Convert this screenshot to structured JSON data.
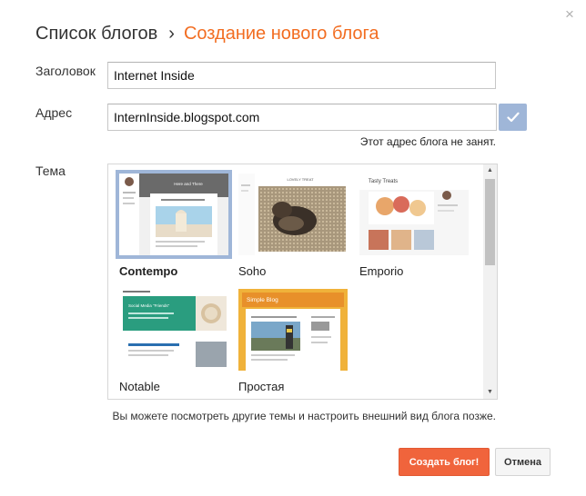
{
  "dialog": {
    "close_glyph": "×",
    "breadcrumb_root": "Список блогов",
    "breadcrumb_sep": "›",
    "breadcrumb_current": "Создание нового блога"
  },
  "form": {
    "title_label": "Заголовок",
    "title_value": "Internet Inside",
    "address_label": "Адрес",
    "address_value": "InternInside.blogspot.com",
    "address_status": "Этот адрес блога не занят.",
    "theme_label": "Тема"
  },
  "themes": {
    "selected": "Contempo",
    "items": [
      {
        "name": "Contempo",
        "thumb_title": "Here and There"
      },
      {
        "name": "Soho",
        "thumb_title": "LOVELY TREAT"
      },
      {
        "name": "Emporio",
        "thumb_title": "Tasty Treats"
      },
      {
        "name": "Notable",
        "thumb_title": "Social Media \"Friends\""
      },
      {
        "name": "Простая",
        "thumb_title": "Simple Blog"
      }
    ]
  },
  "hint": "Вы можете посмотреть другие темы и настроить внешний вид блога позже.",
  "actions": {
    "create_label": "Создать блог!",
    "cancel_label": "Отмена"
  },
  "colors": {
    "accent": "#f26d21",
    "primary_button": "#f0643c",
    "selection": "#9fb6d8"
  }
}
